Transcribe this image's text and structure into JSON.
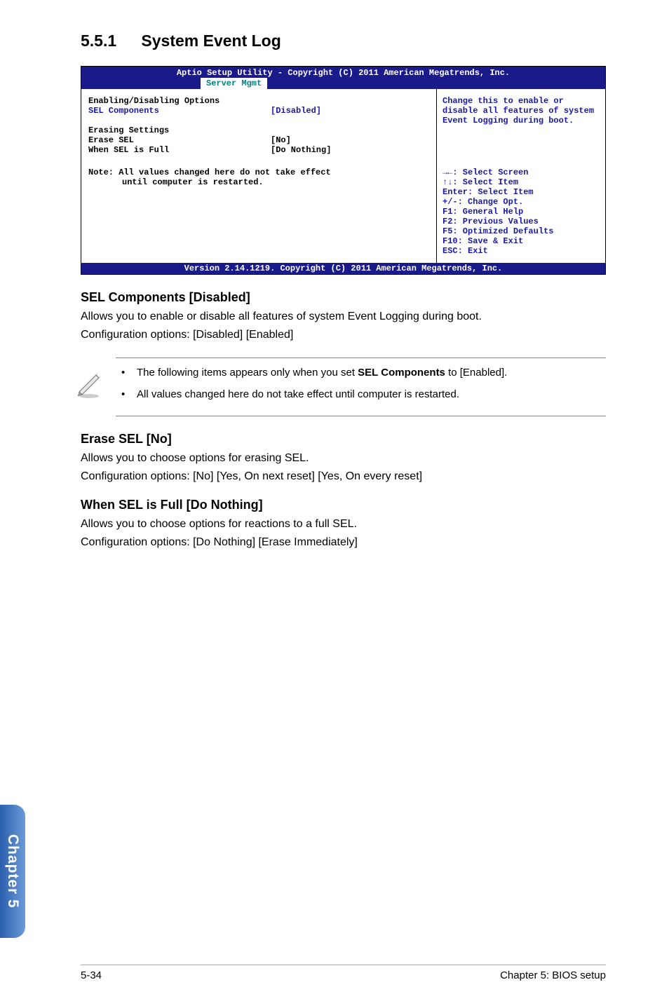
{
  "heading": {
    "number": "5.5.1",
    "title": "System Event Log"
  },
  "bios": {
    "header": "Aptio Setup Utility - Copyright (C) 2011 American Megatrends, Inc.",
    "tab": "Server Mgmt",
    "left": {
      "section1": "Enabling/Disabling Options",
      "sel_label": "SEL Components",
      "sel_value": "[Disabled]",
      "section2": "Erasing Settings",
      "erase_label": "Erase SEL",
      "erase_value": "[No]",
      "full_label": "When SEL is Full",
      "full_value": "[Do Nothing]",
      "note1": "Note: All values changed here do not take effect",
      "note2": "until computer is restarted."
    },
    "right": {
      "desc": "Change this to enable or disable all features of system Event Logging during boot.",
      "help1": "→←: Select Screen",
      "help2": "↑↓:  Select Item",
      "help3": "Enter: Select Item",
      "help4": "+/-: Change Opt.",
      "help5": "F1: General Help",
      "help6": "F2: Previous Values",
      "help7": "F5: Optimized Defaults",
      "help8": "F10: Save & Exit",
      "help9": "ESC: Exit"
    },
    "footer": "Version 2.14.1219. Copyright (C) 2011 American Megatrends, Inc."
  },
  "sections": {
    "sel": {
      "title": "SEL Components [Disabled]",
      "line1": "Allows you to enable or disable all features of system Event Logging during boot.",
      "line2": "Configuration options: [Disabled] [Enabled]"
    },
    "note": {
      "item1a": "The following items appears only when you set ",
      "item1b": "SEL Components",
      "item1c": " to [Enabled].",
      "item2": "All values changed here do not take effect until computer is restarted."
    },
    "erase": {
      "title": "Erase SEL [No]",
      "line1": "Allows you to choose options for erasing SEL.",
      "line2": "Configuration options: [No] [Yes, On next reset] [Yes, On every reset]"
    },
    "full": {
      "title": "When SEL is Full [Do Nothing]",
      "line1": "Allows you to choose options for reactions to a full SEL.",
      "line2": "Configuration options: [Do Nothing] [Erase Immediately]"
    }
  },
  "chapter_tab": "Chapter 5",
  "footer": {
    "left": "5-34",
    "right": "Chapter 5: BIOS setup"
  }
}
